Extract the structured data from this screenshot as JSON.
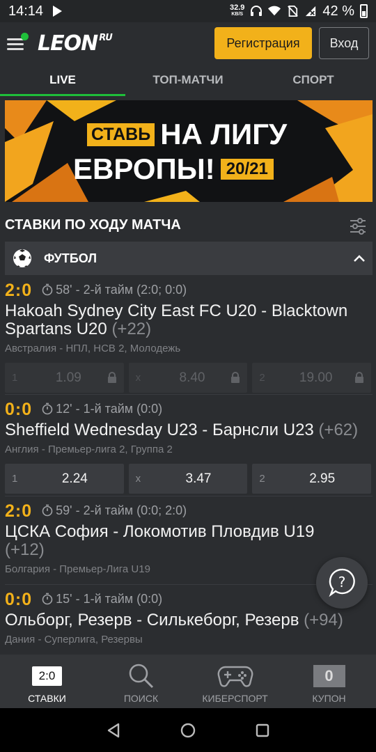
{
  "status_bar": {
    "time": "14:14",
    "net_speed_value": "32.9",
    "net_speed_unit": "KB/S",
    "battery_percent": "42 %"
  },
  "header": {
    "logo_text": "LEON",
    "logo_suffix": "RU",
    "register_label": "Регистрация",
    "login_label": "Вход",
    "accent_color": "#f2b11a",
    "brand_green": "#1fbf3a"
  },
  "tabs": [
    {
      "label": "LIVE",
      "active": true
    },
    {
      "label": "ТОП-МАТЧИ",
      "active": false
    },
    {
      "label": "СПОРТ",
      "active": false
    }
  ],
  "banner": {
    "tag": "СТАВЬ",
    "line1": "НА ЛИГУ",
    "line2": "ЕВРОПЫ!",
    "season": "20/21"
  },
  "section": {
    "title": "СТАВКИ ПО ХОДУ МАТЧА"
  },
  "sport": {
    "name": "ФУТБОЛ",
    "icon": "soccer-ball-icon"
  },
  "matches": [
    {
      "score": "2:0",
      "time": "58' - 2-й тайм (2:0; 0:0)",
      "teams": "Hakoah Sydney City East FC U20 - Blacktown Spartans U20",
      "more": "(+22)",
      "league": "Австралия - НПЛ, НСВ 2, Молодежь",
      "odds": [
        {
          "label": "1",
          "value": "1.09",
          "locked": true
        },
        {
          "label": "x",
          "value": "8.40",
          "locked": true
        },
        {
          "label": "2",
          "value": "19.00",
          "locked": true
        }
      ]
    },
    {
      "score": "0:0",
      "time": "12' - 1-й тайм (0:0)",
      "teams": "Sheffield Wednesday U23 - Барнсли U23",
      "more": "(+62)",
      "league": "Англия - Премьер-лига 2, Группа 2",
      "odds": [
        {
          "label": "1",
          "value": "2.24",
          "locked": false
        },
        {
          "label": "x",
          "value": "3.47",
          "locked": false
        },
        {
          "label": "2",
          "value": "2.95",
          "locked": false
        }
      ]
    },
    {
      "score": "2:0",
      "time": "59' - 2-й тайм (0:0; 2:0)",
      "teams": "ЦСКА София - Локомотив Пловдив U19",
      "more": "(+12)",
      "league": "Болгария - Премьер-Лига U19"
    },
    {
      "score": "0:0",
      "time": "15' - 1-й тайм (0:0)",
      "teams": "Ольборг, Резерв - Силькеборг, Резерв",
      "more": "(+94)",
      "league": "Дания - Суперлига, Резервы"
    }
  ],
  "bottom_nav": [
    {
      "label": "СТАВКИ",
      "badge": "2:0",
      "active": true
    },
    {
      "label": "ПОИСК",
      "icon": "search-icon",
      "active": false
    },
    {
      "label": "КИБЕРСПОРТ",
      "icon": "gamepad-icon",
      "active": false
    },
    {
      "label": "КУПОН",
      "badge": "0",
      "active": false
    }
  ]
}
